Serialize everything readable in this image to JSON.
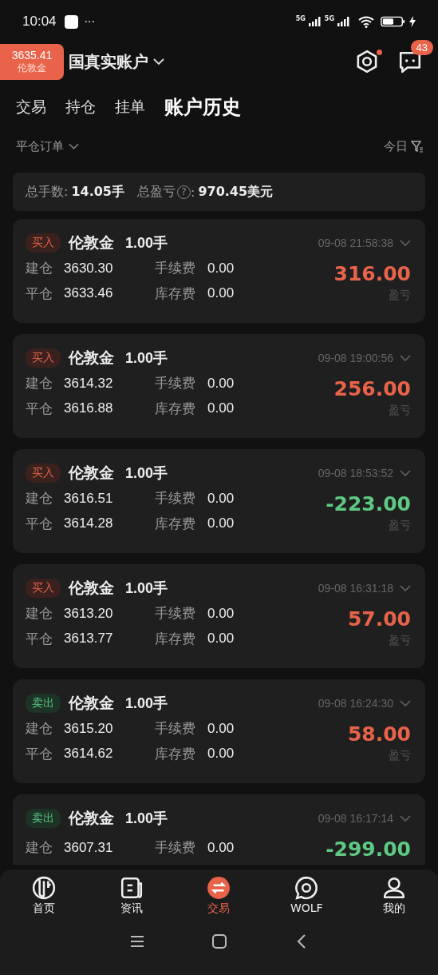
{
  "status_bar": {
    "time": "10:04",
    "more": "···",
    "network_1": "5G",
    "network_2": "5G"
  },
  "header": {
    "price_badge": {
      "price": "3635.41",
      "symbol": "伦敦金"
    },
    "account": "国真实账户",
    "settings_dot": true,
    "messages_badge": "43"
  },
  "tabs": [
    {
      "label": "交易",
      "selected": false
    },
    {
      "label": "持仓",
      "selected": false
    },
    {
      "label": "挂单",
      "selected": false
    },
    {
      "label": "账户历史",
      "selected": true
    }
  ],
  "filter": {
    "order_type": "平仓订单",
    "period": "今日"
  },
  "summary": {
    "lots_label": "总手数:",
    "lots": "14.05手",
    "pnl_label": "总盈亏",
    "help": "?",
    "colon": ":",
    "pnl": "970.45美元"
  },
  "orders": [
    {
      "kind": "buy",
      "side_label": "买入",
      "symbol": "伦敦金",
      "lots": "1.00手",
      "time": "09-08 21:58:38",
      "open_label": "建仓",
      "open": "3630.30",
      "fee_label": "手续费",
      "fee": "0.00",
      "close_label": "平仓",
      "close": "3633.46",
      "swap_label": "库存费",
      "swap": "0.00",
      "profit": true,
      "pnl": "316.00",
      "pnl_label": "盈亏"
    },
    {
      "kind": "buy",
      "side_label": "买入",
      "symbol": "伦敦金",
      "lots": "1.00手",
      "time": "09-08 19:00:56",
      "open_label": "建仓",
      "open": "3614.32",
      "fee_label": "手续费",
      "fee": "0.00",
      "close_label": "平仓",
      "close": "3616.88",
      "swap_label": "库存费",
      "swap": "0.00",
      "profit": true,
      "pnl": "256.00",
      "pnl_label": "盈亏"
    },
    {
      "kind": "buy",
      "side_label": "买入",
      "symbol": "伦敦金",
      "lots": "1.00手",
      "time": "09-08 18:53:52",
      "open_label": "建仓",
      "open": "3616.51",
      "fee_label": "手续费",
      "fee": "0.00",
      "close_label": "平仓",
      "close": "3614.28",
      "swap_label": "库存费",
      "swap": "0.00",
      "profit": false,
      "pnl": "-223.00",
      "pnl_label": "盈亏"
    },
    {
      "kind": "buy",
      "side_label": "买入",
      "symbol": "伦敦金",
      "lots": "1.00手",
      "time": "09-08 16:31:18",
      "open_label": "建仓",
      "open": "3613.20",
      "fee_label": "手续费",
      "fee": "0.00",
      "close_label": "平仓",
      "close": "3613.77",
      "swap_label": "库存费",
      "swap": "0.00",
      "profit": true,
      "pnl": "57.00",
      "pnl_label": "盈亏"
    },
    {
      "kind": "sell",
      "side_label": "卖出",
      "symbol": "伦敦金",
      "lots": "1.00手",
      "time": "09-08 16:24:30",
      "open_label": "建仓",
      "open": "3615.20",
      "fee_label": "手续费",
      "fee": "0.00",
      "close_label": "平仓",
      "close": "3614.62",
      "swap_label": "库存费",
      "swap": "0.00",
      "profit": true,
      "pnl": "58.00",
      "pnl_label": "盈亏"
    },
    {
      "kind": "sell",
      "side_label": "卖出",
      "symbol": "伦敦金",
      "lots": "1.00手",
      "time": "09-08 16:17:14",
      "open_label": "建仓",
      "open": "3607.31",
      "fee_label": "手续费",
      "fee": "0.00",
      "profit": false,
      "pnl": "-299.00"
    }
  ],
  "bottom_nav": [
    {
      "label": "首页",
      "selected": false
    },
    {
      "label": "资讯",
      "selected": false
    },
    {
      "label": "交易",
      "selected": true
    },
    {
      "label": "WOLF",
      "selected": false
    },
    {
      "label": "我的",
      "selected": false
    }
  ]
}
